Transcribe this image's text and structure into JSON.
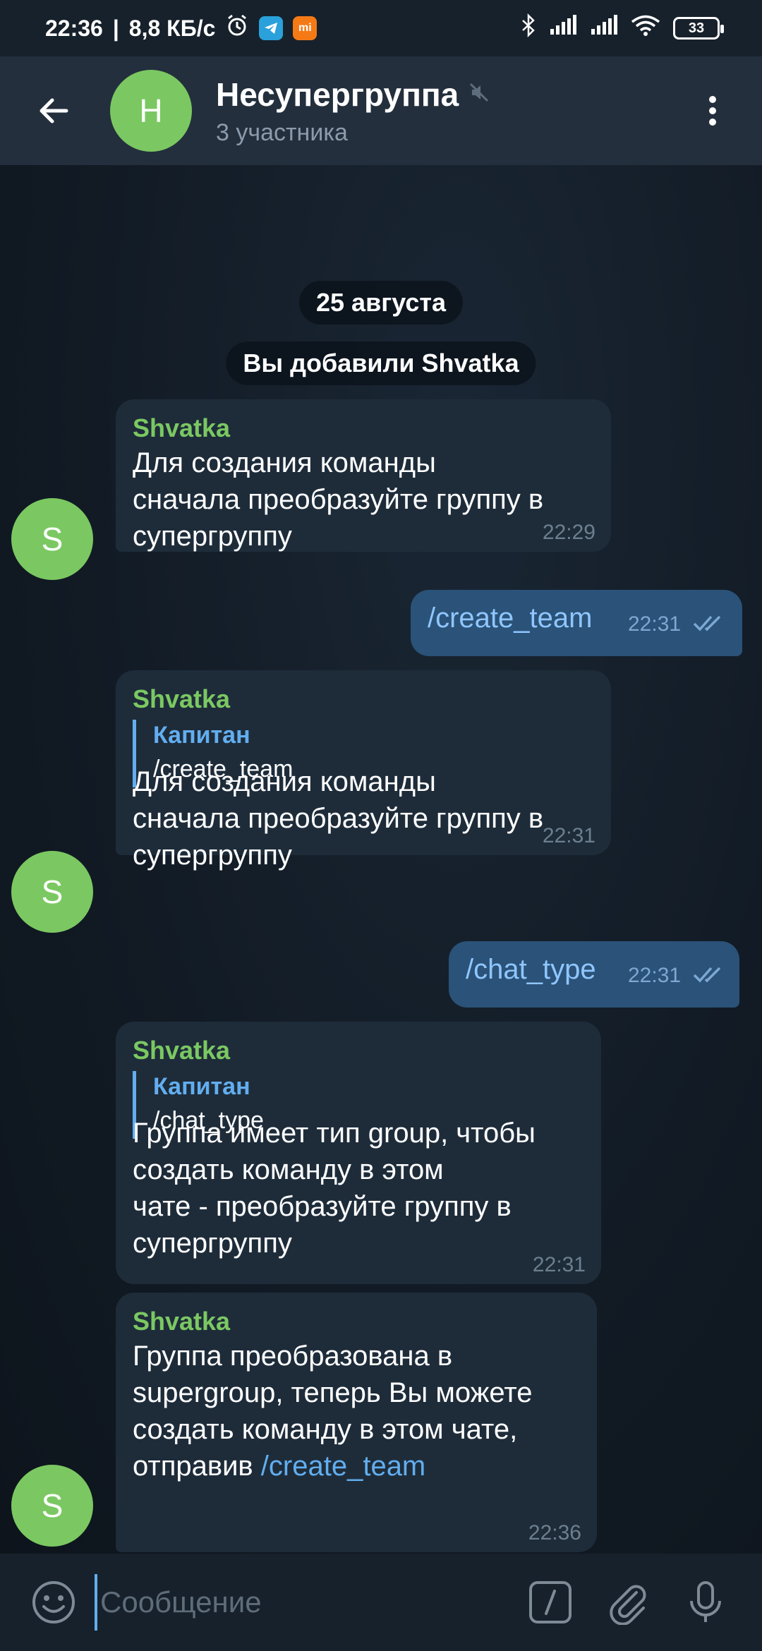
{
  "status_bar": {
    "time": "22:36",
    "speed": "8,8 КБ/с",
    "battery": "33",
    "mi_label": "mi"
  },
  "header": {
    "avatar_letter": "Н",
    "title": "Несупергруппа",
    "subtitle": "3 участника"
  },
  "service": {
    "date": "25 августа",
    "added": "Вы добавили Shvatka"
  },
  "messages": [
    {
      "sender": "Shvatka",
      "lines": [
        "Для создания команды",
        "сначала преобразуйте группу в",
        "супергруппу"
      ],
      "time": "22:29"
    },
    {
      "text": "/create_team",
      "time": "22:31"
    },
    {
      "sender": "Shvatka",
      "reply_name": "Капитан",
      "reply_text": "/create_team",
      "lines": [
        "Для создания команды",
        "сначала преобразуйте группу в",
        "супергруппу"
      ],
      "time": "22:31"
    },
    {
      "text": "/chat_type",
      "time": "22:31"
    },
    {
      "sender": "Shvatka",
      "reply_name": "Капитан",
      "reply_text": "/chat_type",
      "lines": [
        "Группа имеет тип group, чтобы",
        "создать команду в этом",
        "чате - преобразуйте группу в",
        "супергруппу"
      ],
      "time": "22:31"
    },
    {
      "sender": "Shvatka",
      "lines": [
        "Группа преобразована в",
        "supergroup, теперь Вы можете",
        "создать команду в этом чате,"
      ],
      "last_line_prefix": "отправив ",
      "last_line_link": "/create_team",
      "time": "22:36"
    }
  ],
  "sender_avatar_letter": "S",
  "input": {
    "placeholder": "Сообщение"
  },
  "colors": {
    "accent_green": "#7bc862",
    "link_blue": "#62aeef",
    "incoming_bubble": "#1e2c3a",
    "outgoing_bubble": "#2b5278",
    "header_bg": "#242f3d"
  }
}
